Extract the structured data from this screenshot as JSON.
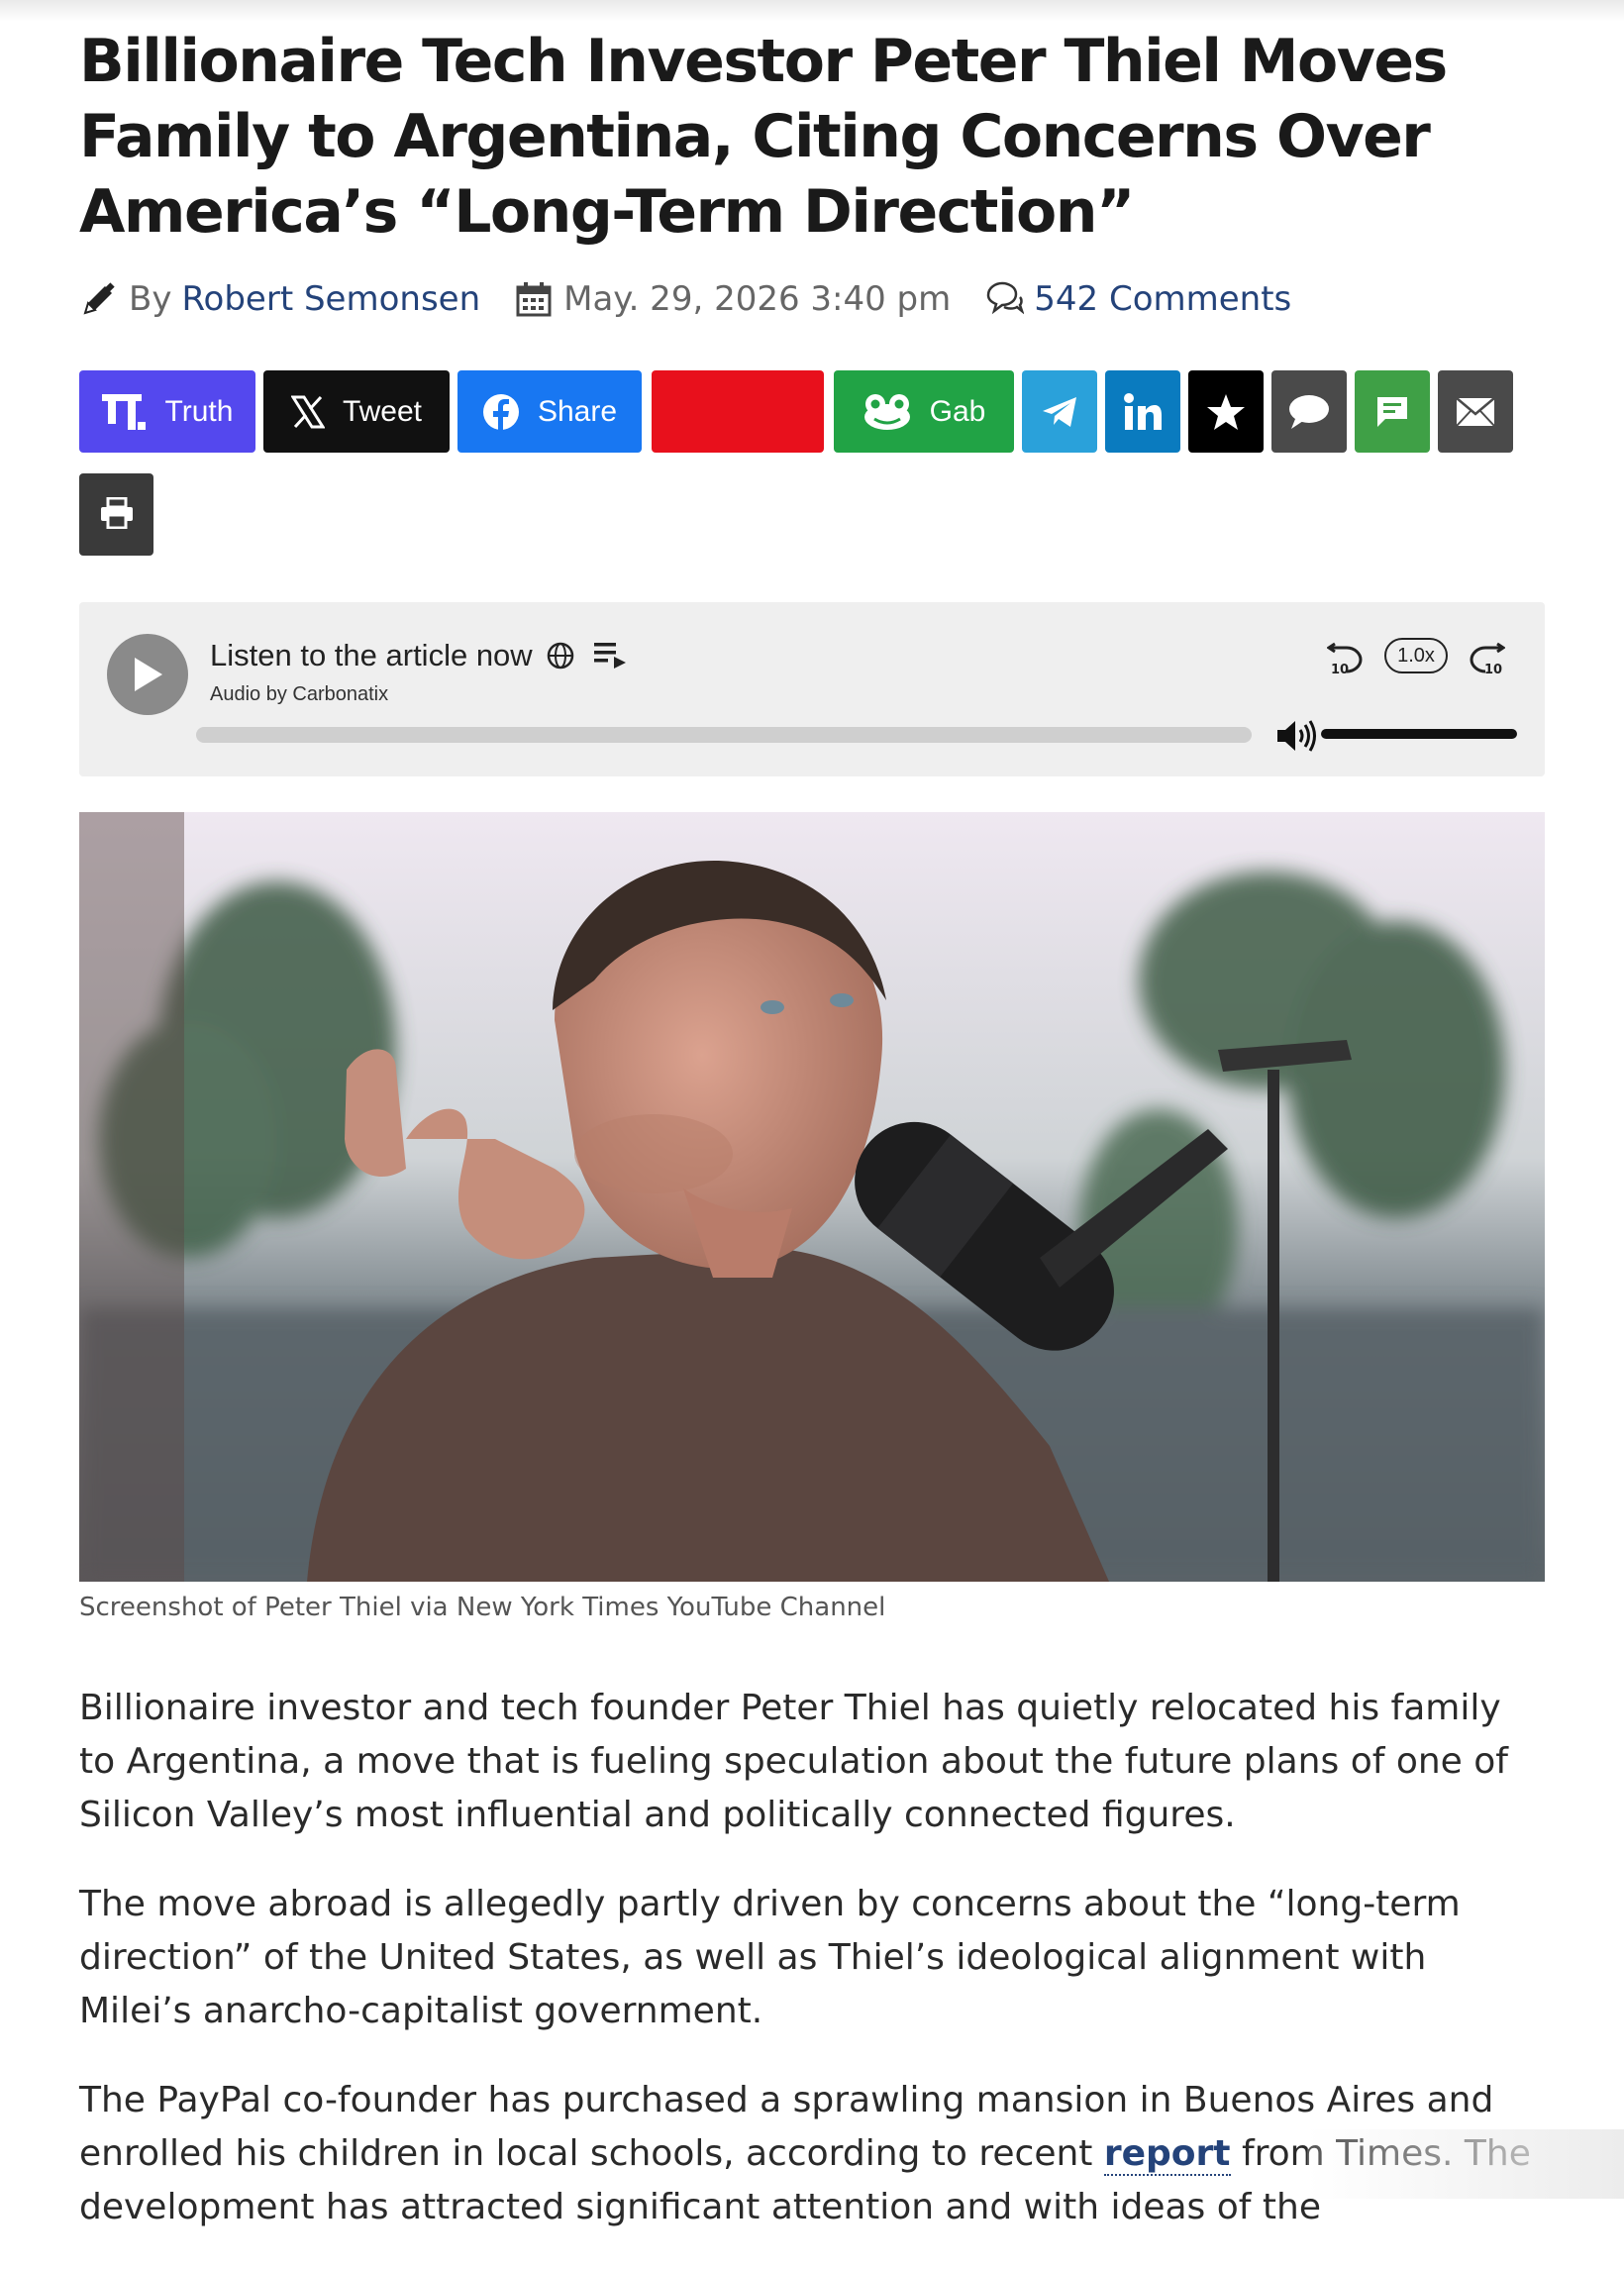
{
  "article": {
    "title": "Billionaire Tech Investor Peter Thiel Moves Family to Argentina, Citing Concerns Over America’s “Long-Term Direction”",
    "byline_prefix": "By",
    "author": "Robert Semonsen",
    "date": "May. 29, 2026 3:40 pm",
    "comments": "542 Comments"
  },
  "share": {
    "truth_label": "Truth",
    "tweet_label": "Tweet",
    "share_label": "Share",
    "gab_label": "Gab",
    "colors": {
      "truth": "#5448ee",
      "x": "#111111",
      "facebook": "#1877f2",
      "redacted": "#e8101c",
      "gab": "#21a345",
      "telegram": "#2aa1da",
      "linkedin": "#0a7bbf",
      "star": "#000000",
      "comment": "#4a4a4a",
      "sms": "#3fa046",
      "email": "#4a4a4a",
      "print": "#3a3a3a"
    }
  },
  "player": {
    "title": "Listen to the article now",
    "credit": "Audio by Carbonatix",
    "speed": "1.0x",
    "progress": 0,
    "volume": 1.0
  },
  "image": {
    "caption": "Screenshot of Peter Thiel via New York Times YouTube Channel"
  },
  "body": {
    "p1": "Billionaire investor and tech founder Peter Thiel has quietly relocated his family to Argentina, a move that is fueling speculation about the future plans of one of Silicon Valley’s most influential and politically connected figures.",
    "p2": "The move abroad is allegedly partly driven by concerns about the “long-term direction” of the United States, as well as Thiel’s ideological alignment with Milei’s anarcho-capitalist government.",
    "p3_before": "The PayPal co-founder has purchased a sprawling mansion in Buenos Aires and enrolled his children in local schools, according to recent ",
    "p3_link": "report",
    "p3_after": " from Times. The development has attracted significant attention and with ideas of the"
  }
}
